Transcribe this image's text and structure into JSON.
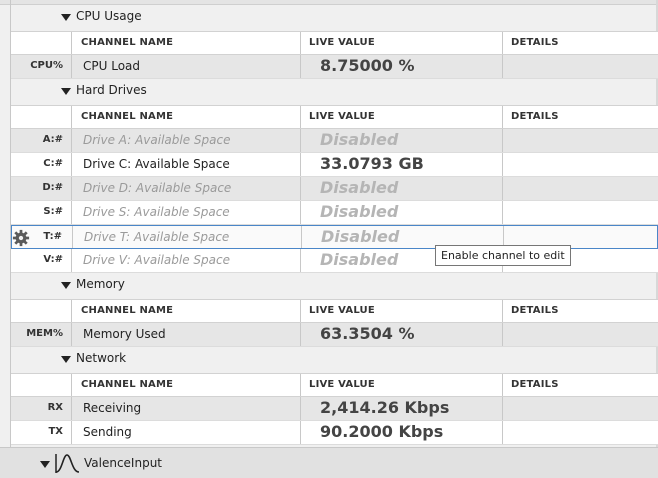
{
  "columns": {
    "name": "CHANNEL NAME",
    "value": "LIVE VALUE",
    "details": "DETAILS"
  },
  "groups": {
    "cpu": {
      "title": "CPU Usage",
      "rows": [
        {
          "code": "CPU%",
          "name": "CPU Load",
          "value": "8.75000 %"
        }
      ]
    },
    "drives": {
      "title": "Hard Drives",
      "rows": [
        {
          "code": "A:#",
          "name": "Drive A: Available Space",
          "value": "Disabled"
        },
        {
          "code": "C:#",
          "name": "Drive C: Available Space",
          "value": "33.0793 GB"
        },
        {
          "code": "D:#",
          "name": "Drive D: Available Space",
          "value": "Disabled"
        },
        {
          "code": "S:#",
          "name": "Drive S: Available Space",
          "value": "Disabled"
        },
        {
          "code": "T:#",
          "name": "Drive T: Available Space",
          "value": "Disabled"
        },
        {
          "code": "V:#",
          "name": "Drive V: Available Space",
          "value": "Disabled"
        }
      ]
    },
    "memory": {
      "title": "Memory",
      "rows": [
        {
          "code": "MEM%",
          "name": "Memory Used",
          "value": "63.3504 %"
        }
      ]
    },
    "network": {
      "title": "Network",
      "rows": [
        {
          "code": "RX",
          "name": "Receiving",
          "value": "2,414.26 Kbps"
        },
        {
          "code": "TX",
          "name": "Sending",
          "value": "90.2000 Kbps"
        }
      ]
    }
  },
  "tooltip": "Enable channel to edit",
  "bottom_group": {
    "title": "ValenceInput"
  },
  "icons": {
    "settings": "gear-icon",
    "collapse": "triangle-down-icon",
    "signal": "waveform-icon"
  }
}
